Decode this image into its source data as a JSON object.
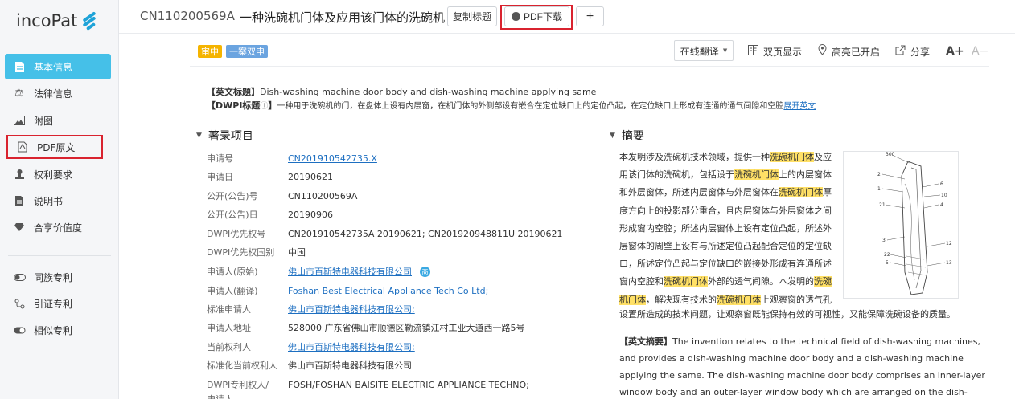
{
  "brand": {
    "name": "incoPat",
    "accent": "#1ea3d8"
  },
  "sidebar": {
    "items": [
      {
        "label": "基本信息",
        "icon": "file-icon"
      },
      {
        "label": "法律信息",
        "icon": "scale-icon"
      },
      {
        "label": "附图",
        "icon": "image-icon"
      },
      {
        "label": "PDF原文",
        "icon": "pdf-icon"
      },
      {
        "label": "权利要求",
        "icon": "stamp-icon"
      },
      {
        "label": "说明书",
        "icon": "document-icon"
      },
      {
        "label": "合享价值度",
        "icon": "diamond-icon"
      },
      {
        "label": "同族专利",
        "icon": "toggle-icon"
      },
      {
        "label": "引证专利",
        "icon": "link-icon"
      },
      {
        "label": "相似专利",
        "icon": "toggle-icon"
      }
    ]
  },
  "header": {
    "patent_number": "CN110200569A",
    "title": "一种洗碗机门体及应用该门体的洗碗机",
    "copy_title": "复制标题",
    "pdf_download": "PDF下载",
    "add": "+"
  },
  "toolbar": {
    "status_badge": "审中",
    "case_badge": "一案双申",
    "translate": "在线翻译",
    "dual_page": "双页显示",
    "highlight": "高亮已开启",
    "share": "分享",
    "font_up": "A+",
    "font_down": "A−"
  },
  "titles": {
    "en_label": "【英文标题】",
    "en_title": "Dish-washing machine door body and dish-washing machine applying same",
    "dwpi_label": "【DWPI标题",
    "dwpi_info": "ⓘ",
    "dwpi_close": "】",
    "dwpi_title": "一种用于洗碗机的门，在盘体上设有内层窗，在机门体的外侧部设有嵌合在定位缺口上的定位凸起，在定位缺口上形成有连通的通气间隙和空腔",
    "expand_en": "展开英文"
  },
  "bibliography": {
    "heading": "著录项目",
    "rows": [
      {
        "label": "申请号",
        "value": "CN201910542735.X",
        "link": true
      },
      {
        "label": "申请日",
        "value": "20190621"
      },
      {
        "label": "公开(公告)号",
        "value": "CN110200569A"
      },
      {
        "label": "公开(公告)日",
        "value": "20190906"
      },
      {
        "label": "DWPI优先权号",
        "value": "CN201910542735A 20190621; CN201920948811U 20190621"
      },
      {
        "label": "DWPI优先权国别",
        "value": "中国"
      },
      {
        "label": "申请人(原始)",
        "value": "佛山市百斯特电器科技有限公司",
        "link": true
      },
      {
        "label": "申请人(翻译)",
        "value": "Foshan Best Electrical Appliance Tech Co Ltd;",
        "link": true
      },
      {
        "label": "标准申请人",
        "value": "佛山市百斯特电器科技有限公司;",
        "link": true
      },
      {
        "label": "申请人地址",
        "value": "528000 广东省佛山市顺德区勒流镇江村工业大道西一路5号"
      },
      {
        "label": "当前权利人",
        "value": "佛山市百斯特电器科技有限公司;",
        "link": true
      },
      {
        "label": "标准化当前权利人",
        "value": "佛山市百斯特电器科技有限公司"
      },
      {
        "label": "DWPI专利权人/",
        "value": "FOSH/FOSHAN BAISITE ELECTRIC APPLIANCE TECHNO;"
      },
      {
        "label": "申请人",
        "value": ""
      }
    ],
    "applicant_tag": "商"
  },
  "abstract": {
    "heading": "摘要",
    "parts": [
      {
        "t": "本发明涉及洗碗机技术领域，提供一种",
        "h": false
      },
      {
        "t": "洗碗机门体",
        "h": true
      },
      {
        "t": "及应用该门体的洗碗机，包括设于",
        "h": false
      },
      {
        "t": "洗碗机门体",
        "h": true
      },
      {
        "t": "上的内层窗体和外层窗体，所述内层窗体与外层窗体在",
        "h": false
      },
      {
        "t": "洗碗机门体",
        "h": true
      },
      {
        "t": "厚度方向上的投影部分重合，且内层窗体与外层窗体之间形成窗内空腔；所述内层窗体上设有定位凸起，所述外层窗体的周壁上设有与所述定位凸起配合定位的定位缺口，所述定位凸起与定位缺口的嵌接处形成有连通所述窗内空腔和",
        "h": false
      },
      {
        "t": "洗碗机门体",
        "h": true
      },
      {
        "t": "外部的透气间隙。本发明的",
        "h": false
      },
      {
        "t": "洗碗机门体",
        "h": true
      },
      {
        "t": "，解决现有技术的",
        "h": false
      },
      {
        "t": "洗碗机门体",
        "h": true
      },
      {
        "t": "上观察窗的透气孔",
        "h": false
      }
    ],
    "tail": "设置所造成的技术问题，让观察窗既能保持有效的可视性，又能保障洗碗设备的质量。",
    "en_label": "【英文摘要】",
    "en_text": "The invention relates to the technical field of dish-washing machines, and provides a dish-washing machine door body and a dish-washing machine applying the same. The dish-washing machine door body comprises an inner-layer window body and an outer-layer window body which are arranged on the dish-washing machine door",
    "figure_labels": [
      "300",
      "2",
      "6",
      "10",
      "21",
      "4",
      "12",
      "22",
      "13",
      "1",
      "3",
      "5"
    ]
  }
}
